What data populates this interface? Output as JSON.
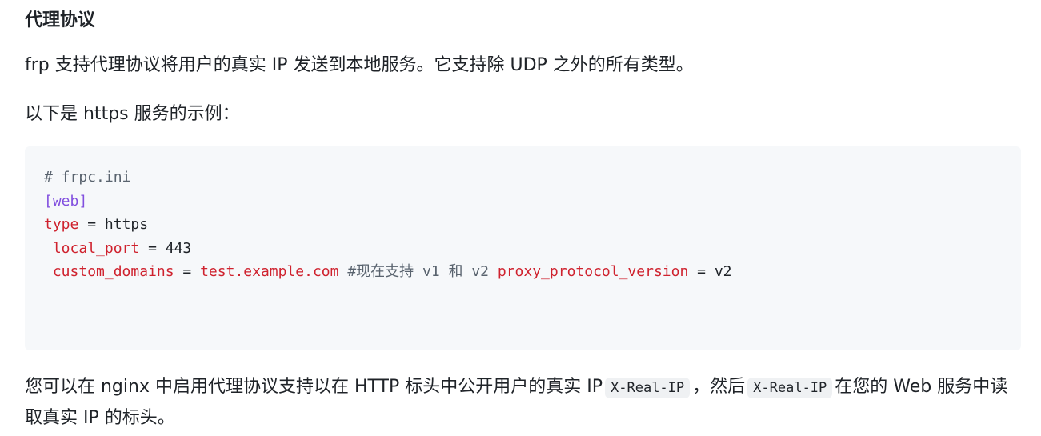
{
  "heading": "代理协议",
  "intro": "frp 支持代理协议将用户的真实 IP 发送到本地服务。它支持除 UDP 之外的所有类型。",
  "example_intro": "以下是 https 服务的示例：",
  "code": {
    "comment": "# frpc.ini",
    "section": "[web]",
    "type_key": "type",
    "type_val": "https",
    "local_port_key": "local_port",
    "local_port_val": "443",
    "custom_domains_key": "custom_domains",
    "custom_domains_val": "test.example.com",
    "inline_comment": "#现在支持 v1 和 v2",
    "proxy_protocol_key": "proxy_protocol_version",
    "proxy_protocol_val": "v2",
    "equals": "="
  },
  "outro": {
    "part1": "您可以在 nginx 中启用代理协议支持以在 HTTP 标头中公开用户的真实 IP",
    "code1": "X-Real-IP",
    "part2": "，然后",
    "code2": "X-Real-IP",
    "part3": "在您的 Web 服务中读取真实 IP 的标头。"
  }
}
